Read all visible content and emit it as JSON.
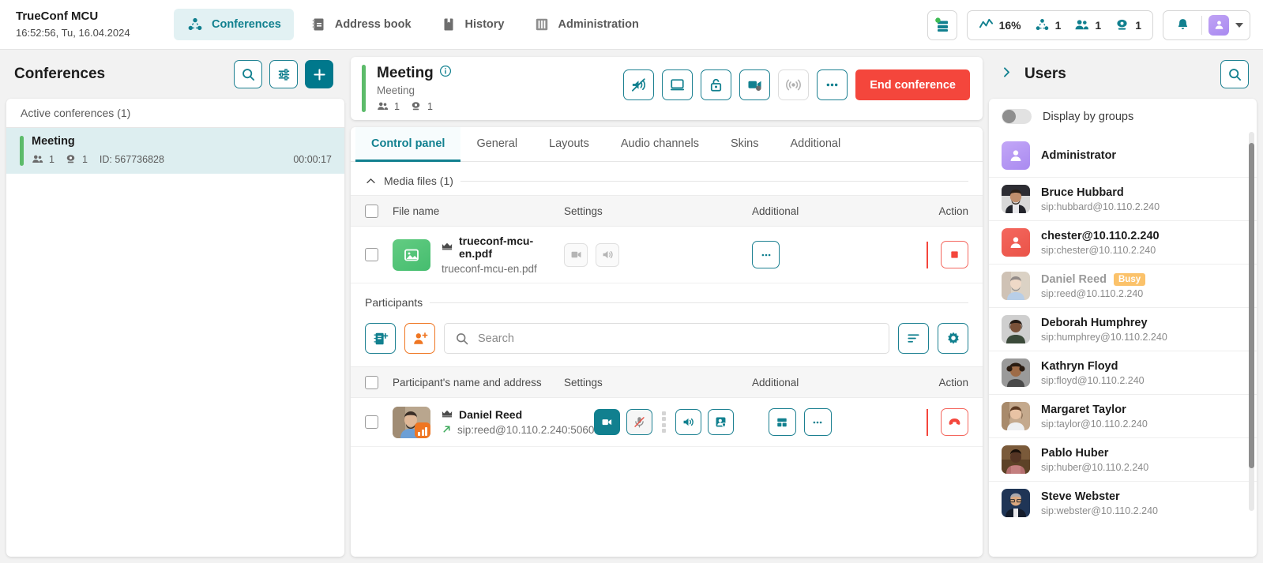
{
  "header": {
    "brand_title": "TrueConf MCU",
    "datetime": "16:52:56, Tu, 16.04.2024",
    "nav": [
      {
        "label": "Conferences",
        "icon": "conference-icon",
        "active": true
      },
      {
        "label": "Address book",
        "icon": "address-book-icon",
        "active": false
      },
      {
        "label": "History",
        "icon": "history-icon",
        "active": false
      },
      {
        "label": "Administration",
        "icon": "administration-icon",
        "active": false
      }
    ],
    "stats": {
      "cpu_percent": "16%",
      "conferences_count": "1",
      "participants_count": "1",
      "video_count": "1"
    }
  },
  "left_panel": {
    "title": "Conferences",
    "search_label": "Search",
    "filter_label": "Filters",
    "add_label": "+",
    "list_header": "Active conferences (1)",
    "conference": {
      "name": "Meeting",
      "participants": "1",
      "video": "1",
      "id": "ID: 567736828",
      "duration": "00:00:17"
    }
  },
  "conference": {
    "title": "Meeting",
    "subtitle": "Meeting",
    "participants": "1",
    "video": "1",
    "actions": [
      {
        "name": "mute-all-icon",
        "muted": false
      },
      {
        "name": "screen-share-icon",
        "muted": false
      },
      {
        "name": "lock-icon",
        "muted": false
      },
      {
        "name": "record-icon",
        "muted": false
      },
      {
        "name": "broadcast-icon",
        "muted": true
      },
      {
        "name": "more-icon",
        "muted": false
      }
    ],
    "end_label": "End conference",
    "tabs": [
      {
        "label": "Control panel",
        "active": true
      },
      {
        "label": "General",
        "active": false
      },
      {
        "label": "Layouts",
        "active": false
      },
      {
        "label": "Audio channels",
        "active": false
      },
      {
        "label": "Skins",
        "active": false
      },
      {
        "label": "Additional",
        "active": false
      }
    ],
    "media_section": {
      "title": "Media files (1)",
      "columns": {
        "name": "File name",
        "settings": "Settings",
        "additional": "Additional",
        "action": "Action"
      },
      "rows": [
        {
          "title": "trueconf-mcu-en.pdf",
          "subtitle": "trueconf-mcu-en.pdf"
        }
      ]
    },
    "participants_section": {
      "title": "Participants",
      "search_placeholder": "Search",
      "search_value": "",
      "columns": {
        "name": "Participant's name and address",
        "settings": "Settings",
        "additional": "Additional",
        "action": "Action"
      },
      "rows": [
        {
          "name": "Daniel Reed",
          "address": "sip:reed@10.110.2.240:5060"
        }
      ]
    }
  },
  "users_panel": {
    "title": "Users",
    "toggle_label": "Display by groups",
    "toggle_on": false,
    "items": [
      {
        "name": "Administrator",
        "sip": "",
        "avatar": "purple",
        "status": "",
        "dim": false
      },
      {
        "name": "Bruce Hubbard",
        "sip": "sip:hubbard@10.110.2.240",
        "avatar": "photo-hubbard",
        "status": "",
        "dim": false
      },
      {
        "name": "chester@10.110.2.240",
        "sip": "sip:chester@10.110.2.240",
        "avatar": "red",
        "status": "",
        "dim": false
      },
      {
        "name": "Daniel Reed",
        "sip": "sip:reed@10.110.2.240",
        "avatar": "photo-reed",
        "status": "Busy",
        "dim": true
      },
      {
        "name": "Deborah Humphrey",
        "sip": "sip:humphrey@10.110.2.240",
        "avatar": "photo-humphrey",
        "status": "",
        "dim": false
      },
      {
        "name": "Kathryn Floyd",
        "sip": "sip:floyd@10.110.2.240",
        "avatar": "photo-floyd",
        "status": "",
        "dim": false
      },
      {
        "name": "Margaret Taylor",
        "sip": "sip:taylor@10.110.2.240",
        "avatar": "photo-taylor",
        "status": "",
        "dim": false
      },
      {
        "name": "Pablo Huber",
        "sip": "sip:huber@10.110.2.240",
        "avatar": "photo-huber",
        "status": "",
        "dim": false
      },
      {
        "name": "Steve Webster",
        "sip": "sip:webster@10.110.2.240",
        "avatar": "photo-webster",
        "status": "",
        "dim": false
      }
    ]
  },
  "colors": {
    "teal": "#11808f",
    "red": "#f4463c",
    "green": "#5cbb6a",
    "orange": "#ef7622",
    "purple": "#a98af0"
  }
}
